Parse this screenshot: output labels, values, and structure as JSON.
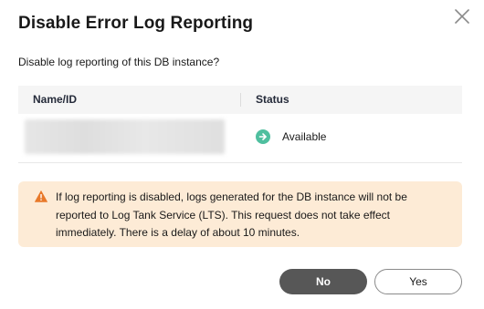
{
  "dialog": {
    "title": "Disable Error Log Reporting",
    "question": "Disable log reporting of this DB instance?",
    "close_icon": "close-icon"
  },
  "table": {
    "columns": [
      "Name/ID",
      "Status"
    ],
    "rows": [
      {
        "name": "",
        "status": "Available",
        "status_icon": "arrow-right-circle-icon",
        "status_color": "#4fbf9f"
      }
    ]
  },
  "alert": {
    "icon": "warning-triangle-icon",
    "color": "#e8792a",
    "background": "#fdebd6",
    "text": "If log reporting is disabled, logs generated for the DB instance will not be reported to Log Tank Service (LTS). This request does not take effect immediately. There is a delay of about 10 minutes."
  },
  "buttons": {
    "no_label": "No",
    "yes_label": "Yes"
  },
  "colors": {
    "primary_button": "#575757",
    "title": "#191919"
  }
}
